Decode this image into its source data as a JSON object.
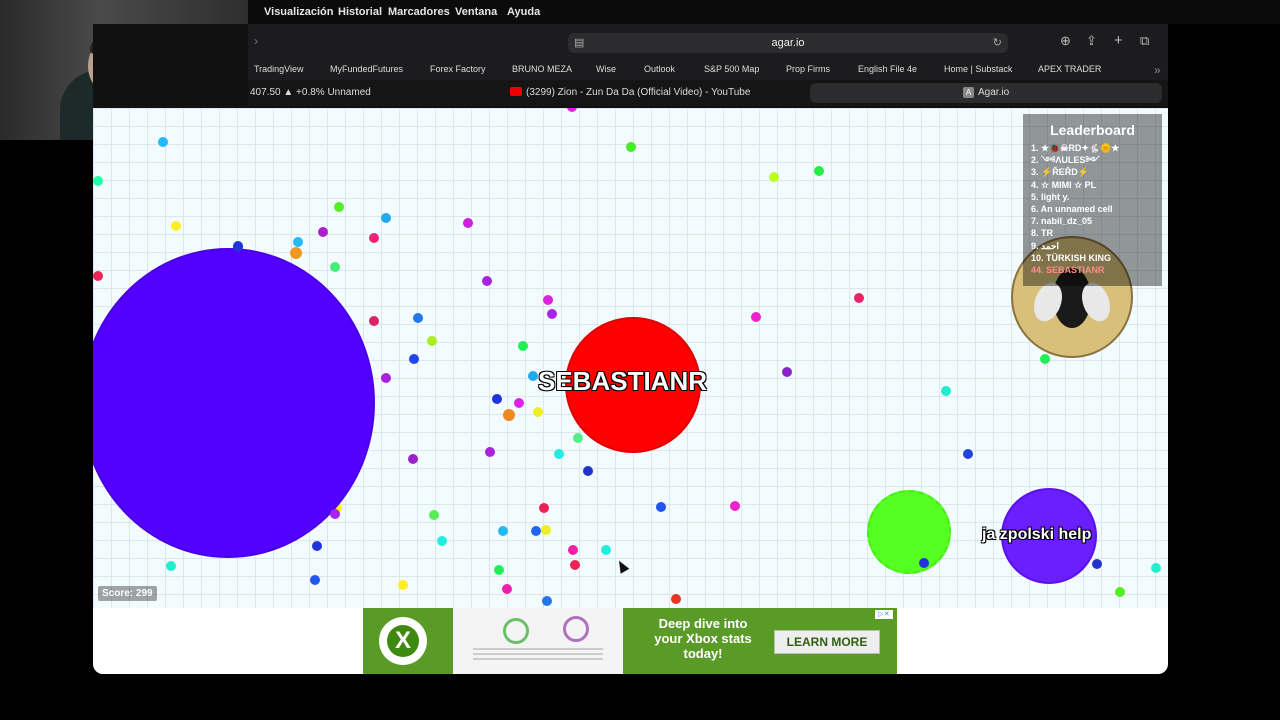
{
  "menubar": {
    "items": [
      "Visualización",
      "Historial",
      "Marcadores",
      "Ventana",
      "Ayuda"
    ]
  },
  "browser": {
    "url": "agar.io",
    "bookmarks": [
      "TradingView",
      "MyFundedFutures",
      "Forex Factory",
      "BRUNO MEZA",
      "Wise",
      "Outlook",
      "S&P 500 Map",
      "Prop Firms",
      "English File 4e",
      "Home | Substack",
      "APEX TRADER"
    ],
    "tabs": [
      {
        "label": "407.50 ▲ +0.8% Unnamed"
      },
      {
        "label": "(3299) Zion - Zun Da Da (Official Video) - YouTube"
      },
      {
        "label": "Agar.io"
      }
    ]
  },
  "game": {
    "player_name": "SEBASTIANR",
    "other_player_name": "ja zpolski help",
    "score": "Score: 299",
    "leaderboard": {
      "title": "Leaderboard",
      "entries": [
        "1. ★🐞☠RD✦🐇🌞★",
        "2. ༺ΛULES༻",
        "3. ⚡ŘEŘD⚡",
        "4. ☆ MIMI ☆ PL",
        "5. light y.",
        "6. An unnamed cell",
        "7. nabil_dz_05",
        "8. TR",
        "9. احمد",
        "10. TÜRKISH KING",
        "44. SEBASTIANR"
      ],
      "highlight_color": "#ff8a8a"
    }
  },
  "ad": {
    "text_lines": [
      "Deep dive into",
      "your Xbox stats",
      "today!"
    ],
    "button": "LEARN MORE"
  },
  "colors": {
    "player_cell": "#ff0000",
    "big_cell": "#5200ff",
    "green_cell": "#55ff22",
    "other_player": "#6a1fff"
  }
}
